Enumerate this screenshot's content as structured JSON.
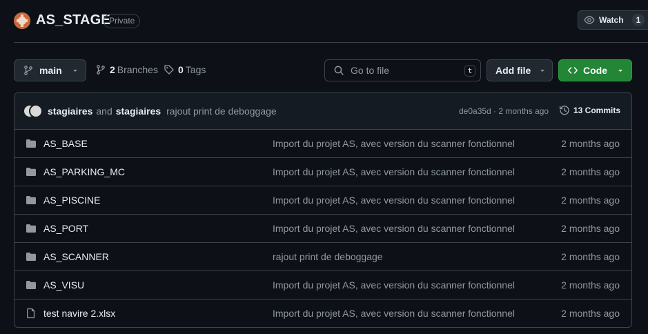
{
  "repo": {
    "name": "AS_STAGE",
    "visibility": "Private"
  },
  "watch": {
    "label": "Watch",
    "count": "1"
  },
  "toolbar": {
    "branch": "main",
    "branches_count": "2",
    "branches_label": "Branches",
    "tags_count": "0",
    "tags_label": "Tags",
    "search_placeholder": "Go to file",
    "search_shortcut": "t",
    "add_file_label": "Add file",
    "code_label": "Code"
  },
  "latest_commit": {
    "author1": "stagiaires",
    "and": "and",
    "author2": "stagiaires",
    "message": "rajout print de deboggage",
    "hash_time": "de0a35d · 2 months ago",
    "commits_label": "13 Commits"
  },
  "files": [
    {
      "type": "folder",
      "name": "AS_BASE",
      "message": "Import du projet AS, avec version du scanner fonctionnel",
      "time": "2 months ago"
    },
    {
      "type": "folder",
      "name": "AS_PARKING_MC",
      "message": "Import du projet AS, avec version du scanner fonctionnel",
      "time": "2 months ago"
    },
    {
      "type": "folder",
      "name": "AS_PISCINE",
      "message": "Import du projet AS, avec version du scanner fonctionnel",
      "time": "2 months ago"
    },
    {
      "type": "folder",
      "name": "AS_PORT",
      "message": "Import du projet AS, avec version du scanner fonctionnel",
      "time": "2 months ago"
    },
    {
      "type": "folder",
      "name": "AS_SCANNER",
      "message": "rajout print de deboggage",
      "time": "2 months ago"
    },
    {
      "type": "folder",
      "name": "AS_VISU",
      "message": "Import du projet AS, avec version du scanner fonctionnel",
      "time": "2 months ago"
    },
    {
      "type": "file",
      "name": "test navire 2.xlsx",
      "message": "Import du projet AS, avec version du scanner fonctionnel",
      "time": "2 months ago"
    }
  ]
}
